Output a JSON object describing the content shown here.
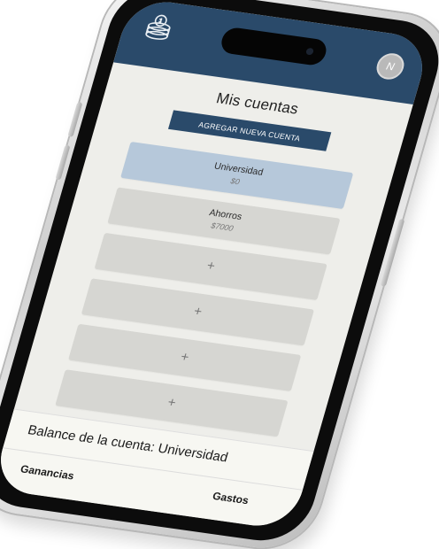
{
  "header": {
    "logo_icon": "coin-stack-icon",
    "avatar_initial": "N",
    "brand_color": "#2a4a6a"
  },
  "main": {
    "title": "Mis cuentas",
    "add_account_label": "AGREGAR NUEVA CUENTA",
    "accounts": [
      {
        "name": "Universidad",
        "amount": "$0",
        "selected": true
      },
      {
        "name": "Ahorros",
        "amount": "$7000",
        "selected": false
      }
    ],
    "empty_slots": [
      "+",
      "+",
      "+",
      "+"
    ]
  },
  "balance": {
    "title": "Balance de la cuenta: Universidad",
    "tabs": {
      "income": "Ganancias",
      "expenses": "Gastos"
    }
  },
  "colors": {
    "selected_account": "#b6c8da",
    "account_card": "#d6d6d2",
    "screen_background": "#eeeeea"
  }
}
